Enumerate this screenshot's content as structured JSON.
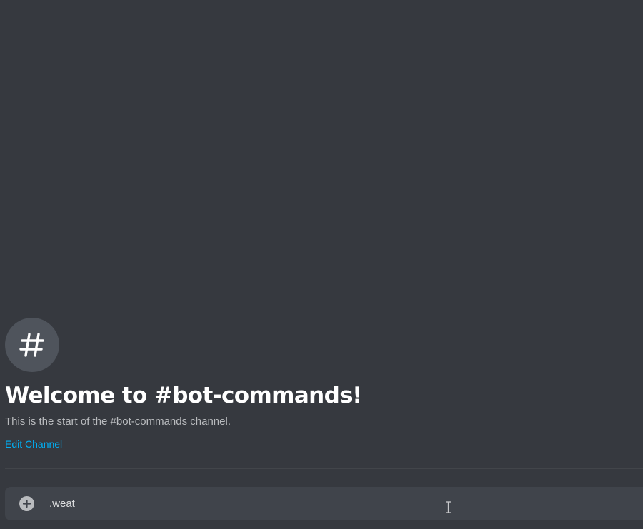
{
  "channel": {
    "icon": "hashtag-icon",
    "welcome_title": "Welcome to #bot-commands!",
    "welcome_subtitle": "This is the start of the #bot-commands channel.",
    "edit_link": "Edit Channel"
  },
  "composer": {
    "attach_icon": "plus-circle-icon",
    "input_value": ".weat"
  },
  "colors": {
    "background": "#36393f",
    "composer": "#40444b",
    "link": "#00aff4",
    "icon_circle": "#4f545c"
  }
}
